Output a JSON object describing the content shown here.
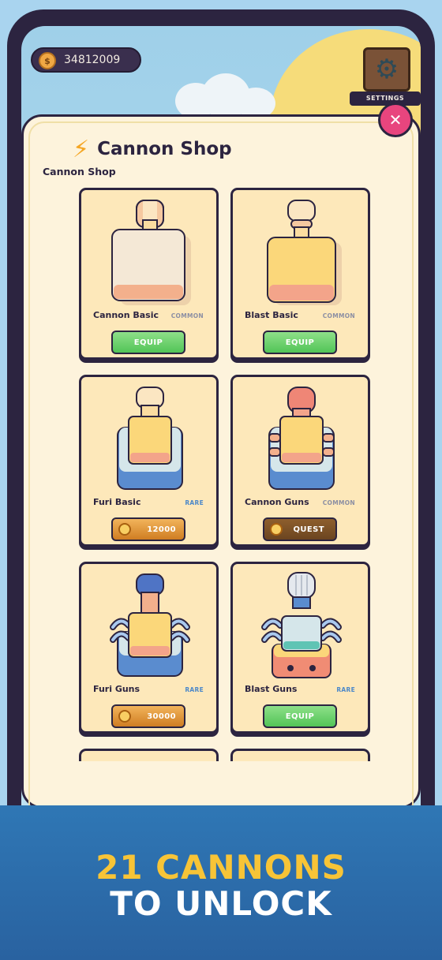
{
  "header": {
    "coins": "34812009",
    "coin_symbol": "$",
    "settings_label": "SETTINGS",
    "close_symbol": "✕"
  },
  "shop": {
    "title": "Cannon Shop",
    "subtitle": "Cannon Shop",
    "title_icon": "lightning-bolt-icon"
  },
  "cards": [
    {
      "name": "Cannon Basic",
      "rarity": "COMMON",
      "action": "equip",
      "button_label": "EQUIP"
    },
    {
      "name": "Blast Basic",
      "rarity": "COMMON",
      "action": "equip",
      "button_label": "EQUIP"
    },
    {
      "name": "Furi Basic",
      "rarity": "RARE",
      "action": "buy",
      "button_label": "12000"
    },
    {
      "name": "Cannon Guns",
      "rarity": "COMMON",
      "action": "quest",
      "button_label": "QUEST"
    },
    {
      "name": "Furi Guns",
      "rarity": "RARE",
      "action": "buy",
      "button_label": "30000"
    },
    {
      "name": "Blast Guns",
      "rarity": "RARE",
      "action": "equip",
      "button_label": "EQUIP"
    }
  ],
  "banner": {
    "line1": "21 CANNONS",
    "line2": "TO UNLOCK"
  },
  "colors": {
    "equip_green": "#52c457",
    "buy_orange": "#cf7d22",
    "quest_brown": "#6b4420",
    "panel_cream": "#fdf3dc",
    "banner_blue": "#2962a0",
    "banner_yellow": "#f7c437",
    "close_pink": "#e8457e"
  }
}
